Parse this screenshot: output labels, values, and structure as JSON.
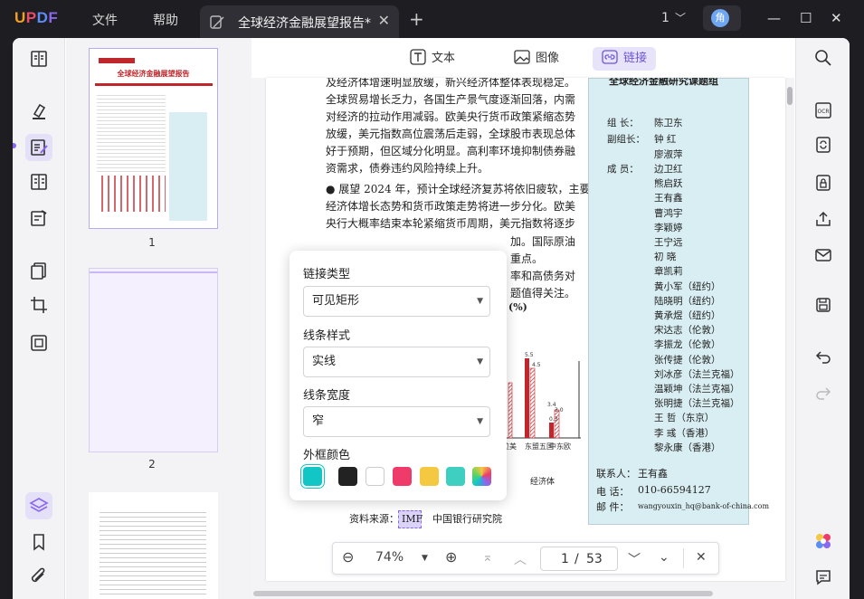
{
  "app": {
    "logo_letters": [
      "U",
      "P",
      "D",
      "F"
    ]
  },
  "menu": {
    "file": "文件",
    "help": "帮助"
  },
  "tab": {
    "title": "全球经济金融展望报告*"
  },
  "topbar": {
    "page_indicator": "1",
    "avatar_initial": "角"
  },
  "toolbar": {
    "text_label": "文本",
    "image_label": "图像",
    "link_label": "链接"
  },
  "thumbnails": [
    {
      "label": "1",
      "title": "全球经济金融展望报告"
    },
    {
      "label": "2"
    }
  ],
  "document": {
    "paragraph_lines": [
      "及经济体增速明显放缓，新兴经济体整体表现稳定。",
      "全球贸易增长乏力，各国生产景气度逐渐回落，内需",
      "对经济的拉动作用减弱。欧美央行货币政策紧缩态势",
      "放缓，美元指数高位震荡后走弱，全球股市表现总体",
      "好于预期，但区域分化明显。高利率环境抑制债券融",
      "资需求，债券违约风险持续上升。",
      "● 展望 2024 年，预计全球经济复苏将依旧疲软，主要",
      "经济体增长态势和货币政策走势将进一步分化。欧美",
      "央行大概率结束本轮紧缩货币周期，美元指数将逐步"
    ],
    "right_fragments": [
      "加。国际原油",
      "重点。",
      "率和高债务对",
      "题值得关注。"
    ],
    "chart_caption_fragment": "(%)",
    "chart_values": [
      "5.5",
      "4.5",
      "3.4",
      "3.0",
      "0.3"
    ],
    "chart_categories": [
      "拉美",
      "东盟五国",
      "中东欧"
    ],
    "chart_footer": "经济体",
    "source_label": "资料来源：",
    "source_highlight": "IMF",
    "source_rest": "中国银行研究院"
  },
  "info_box": {
    "title": "全球经济金融研究课题组",
    "leader_label": "组    长：",
    "leader": "陈卫东",
    "deputy_label": "副组长：",
    "deputies": [
      "钟    红",
      "廖淑萍"
    ],
    "members_label": "成    员：",
    "members": [
      "边卫红",
      "熊启跃",
      "王有鑫",
      "曹鸿宇",
      "李颖婷",
      "王宁远",
      "初    晓",
      "章凯莉",
      "黄小军（纽约）",
      "陆晓明（纽约）",
      "黄承煜（纽约）",
      "宋达志（伦敦）",
      "李振龙（伦敦）",
      "张传捷（伦敦）",
      "刘冰彦（法兰克福）",
      "温颖坤（法兰克福）",
      "张明捷（法兰克福）",
      "王    哲（东京）",
      "李    彧（香港）",
      "黎永康（香港）"
    ],
    "contact_label": "联系人：",
    "contact": "王有鑫",
    "phone_label": "电    话：",
    "phone": "010-66594127",
    "email_label": "邮    件：",
    "email": "wangyouxin_hq@bank-of-china.com"
  },
  "popup": {
    "link_type_label": "链接类型",
    "link_type_value": "可见矩形",
    "line_style_label": "线条样式",
    "line_style_value": "实线",
    "line_width_label": "线条宽度",
    "line_width_value": "窄",
    "border_color_label": "外框颜色",
    "swatches": [
      "#12c6c6",
      "#222222",
      "#ffffff",
      "#ef3b6a",
      "#f5c842",
      "#3fcfc0",
      "gradient"
    ]
  },
  "bottom_bar": {
    "zoom": "74%",
    "current_page": "1",
    "separator": "/",
    "total_pages": "53"
  },
  "colors": {
    "accent": "#8a67f0",
    "link_highlight": "#e7e3fa",
    "info_box_bg": "#d9eef2"
  }
}
